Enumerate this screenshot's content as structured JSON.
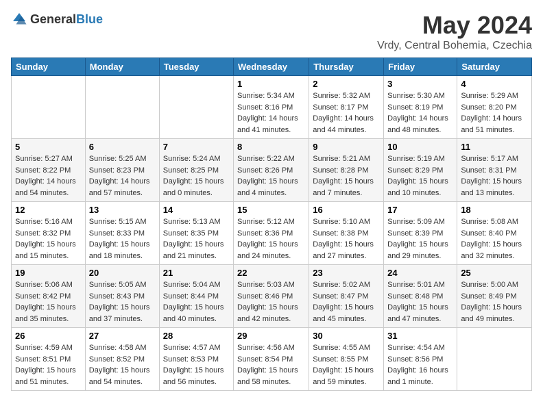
{
  "header": {
    "logo_general": "General",
    "logo_blue": "Blue",
    "month_title": "May 2024",
    "location": "Vrdy, Central Bohemia, Czechia"
  },
  "weekdays": [
    "Sunday",
    "Monday",
    "Tuesday",
    "Wednesday",
    "Thursday",
    "Friday",
    "Saturday"
  ],
  "weeks": [
    [
      {
        "day": "",
        "info": ""
      },
      {
        "day": "",
        "info": ""
      },
      {
        "day": "",
        "info": ""
      },
      {
        "day": "1",
        "info": "Sunrise: 5:34 AM\nSunset: 8:16 PM\nDaylight: 14 hours\nand 41 minutes."
      },
      {
        "day": "2",
        "info": "Sunrise: 5:32 AM\nSunset: 8:17 PM\nDaylight: 14 hours\nand 44 minutes."
      },
      {
        "day": "3",
        "info": "Sunrise: 5:30 AM\nSunset: 8:19 PM\nDaylight: 14 hours\nand 48 minutes."
      },
      {
        "day": "4",
        "info": "Sunrise: 5:29 AM\nSunset: 8:20 PM\nDaylight: 14 hours\nand 51 minutes."
      }
    ],
    [
      {
        "day": "5",
        "info": "Sunrise: 5:27 AM\nSunset: 8:22 PM\nDaylight: 14 hours\nand 54 minutes."
      },
      {
        "day": "6",
        "info": "Sunrise: 5:25 AM\nSunset: 8:23 PM\nDaylight: 14 hours\nand 57 minutes."
      },
      {
        "day": "7",
        "info": "Sunrise: 5:24 AM\nSunset: 8:25 PM\nDaylight: 15 hours\nand 0 minutes."
      },
      {
        "day": "8",
        "info": "Sunrise: 5:22 AM\nSunset: 8:26 PM\nDaylight: 15 hours\nand 4 minutes."
      },
      {
        "day": "9",
        "info": "Sunrise: 5:21 AM\nSunset: 8:28 PM\nDaylight: 15 hours\nand 7 minutes."
      },
      {
        "day": "10",
        "info": "Sunrise: 5:19 AM\nSunset: 8:29 PM\nDaylight: 15 hours\nand 10 minutes."
      },
      {
        "day": "11",
        "info": "Sunrise: 5:17 AM\nSunset: 8:31 PM\nDaylight: 15 hours\nand 13 minutes."
      }
    ],
    [
      {
        "day": "12",
        "info": "Sunrise: 5:16 AM\nSunset: 8:32 PM\nDaylight: 15 hours\nand 15 minutes."
      },
      {
        "day": "13",
        "info": "Sunrise: 5:15 AM\nSunset: 8:33 PM\nDaylight: 15 hours\nand 18 minutes."
      },
      {
        "day": "14",
        "info": "Sunrise: 5:13 AM\nSunset: 8:35 PM\nDaylight: 15 hours\nand 21 minutes."
      },
      {
        "day": "15",
        "info": "Sunrise: 5:12 AM\nSunset: 8:36 PM\nDaylight: 15 hours\nand 24 minutes."
      },
      {
        "day": "16",
        "info": "Sunrise: 5:10 AM\nSunset: 8:38 PM\nDaylight: 15 hours\nand 27 minutes."
      },
      {
        "day": "17",
        "info": "Sunrise: 5:09 AM\nSunset: 8:39 PM\nDaylight: 15 hours\nand 29 minutes."
      },
      {
        "day": "18",
        "info": "Sunrise: 5:08 AM\nSunset: 8:40 PM\nDaylight: 15 hours\nand 32 minutes."
      }
    ],
    [
      {
        "day": "19",
        "info": "Sunrise: 5:06 AM\nSunset: 8:42 PM\nDaylight: 15 hours\nand 35 minutes."
      },
      {
        "day": "20",
        "info": "Sunrise: 5:05 AM\nSunset: 8:43 PM\nDaylight: 15 hours\nand 37 minutes."
      },
      {
        "day": "21",
        "info": "Sunrise: 5:04 AM\nSunset: 8:44 PM\nDaylight: 15 hours\nand 40 minutes."
      },
      {
        "day": "22",
        "info": "Sunrise: 5:03 AM\nSunset: 8:46 PM\nDaylight: 15 hours\nand 42 minutes."
      },
      {
        "day": "23",
        "info": "Sunrise: 5:02 AM\nSunset: 8:47 PM\nDaylight: 15 hours\nand 45 minutes."
      },
      {
        "day": "24",
        "info": "Sunrise: 5:01 AM\nSunset: 8:48 PM\nDaylight: 15 hours\nand 47 minutes."
      },
      {
        "day": "25",
        "info": "Sunrise: 5:00 AM\nSunset: 8:49 PM\nDaylight: 15 hours\nand 49 minutes."
      }
    ],
    [
      {
        "day": "26",
        "info": "Sunrise: 4:59 AM\nSunset: 8:51 PM\nDaylight: 15 hours\nand 51 minutes."
      },
      {
        "day": "27",
        "info": "Sunrise: 4:58 AM\nSunset: 8:52 PM\nDaylight: 15 hours\nand 54 minutes."
      },
      {
        "day": "28",
        "info": "Sunrise: 4:57 AM\nSunset: 8:53 PM\nDaylight: 15 hours\nand 56 minutes."
      },
      {
        "day": "29",
        "info": "Sunrise: 4:56 AM\nSunset: 8:54 PM\nDaylight: 15 hours\nand 58 minutes."
      },
      {
        "day": "30",
        "info": "Sunrise: 4:55 AM\nSunset: 8:55 PM\nDaylight: 15 hours\nand 59 minutes."
      },
      {
        "day": "31",
        "info": "Sunrise: 4:54 AM\nSunset: 8:56 PM\nDaylight: 16 hours\nand 1 minute."
      },
      {
        "day": "",
        "info": ""
      }
    ]
  ]
}
